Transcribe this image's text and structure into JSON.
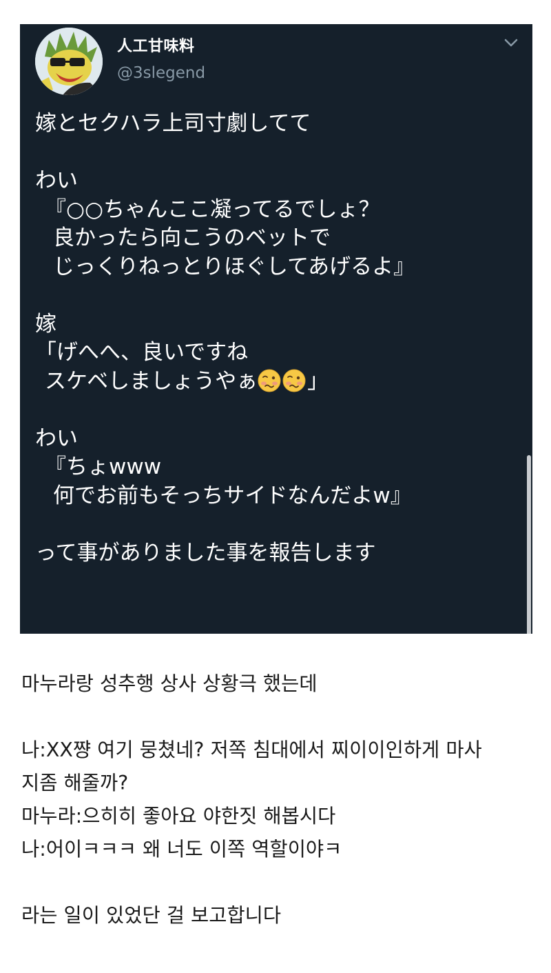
{
  "tweet": {
    "display_name": "人工甘味料",
    "handle": "@3slegend",
    "text_lines": {
      "l1": "嫁とセクハラ上司寸劇してて",
      "l2": "わい",
      "l3": "『○○ちゃんここ凝ってるでしょ？",
      "l4": "良かったら向こうのベットで",
      "l5": "じっくりねっとりほぐしてあげるよ』",
      "l6": "嫁",
      "l7": "「げへへ、良いですね",
      "l8_pre": "スケベしましょうやぁ",
      "l8_post": "」",
      "l9": "わい",
      "l10": "『ちょwww",
      "l11": "何でお前もそっちサイドなんだよw』",
      "l12": "って事がありました事を報告します"
    },
    "icons": {
      "avatar": "cartoon-bird-with-sunglasses",
      "menu": "chevron-down-icon",
      "emoji": "woozy-face-emoji"
    },
    "colors": {
      "card_bg": "#15202b",
      "text": "#ffffff",
      "handle": "#8899a6"
    }
  },
  "translation": {
    "l1": "마누라랑 성추행 상사 상황극 했는데",
    "l2": "나:XX쨩 여기 뭉쳤네? 저쪽 침대에서 찌이이인하게 마사",
    "l3": "지좀 해줄까?",
    "l4": "마누라:으히히 좋아요 야한짓 해봅시다",
    "l5": "나:어이ㅋㅋㅋ 왜 너도 이쪽 역할이야ㅋ",
    "l6": "라는 일이 있었단 걸 보고합니다"
  }
}
